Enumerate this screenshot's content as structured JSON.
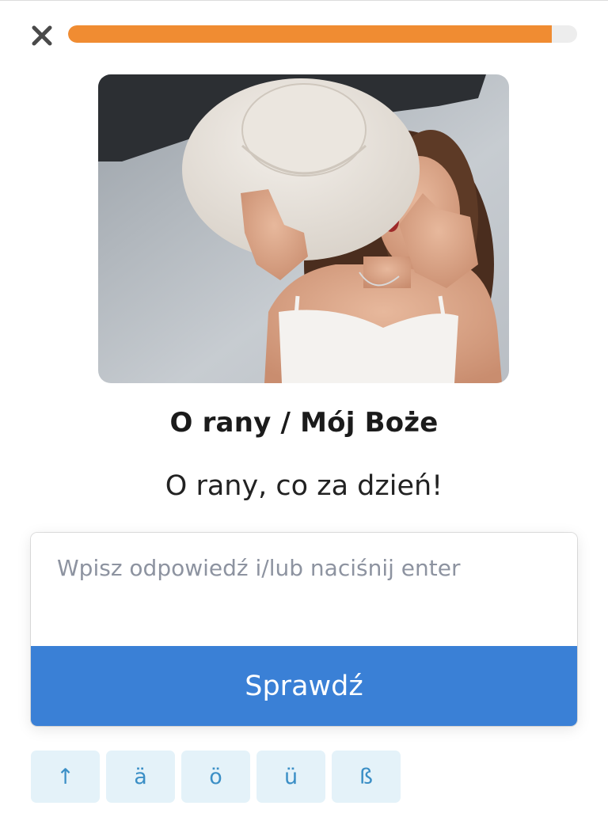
{
  "progress": {
    "fraction": 0.95,
    "color": "#f08c32"
  },
  "header": {
    "close_icon": "close-icon"
  },
  "card": {
    "title": "O rany / Mój Boże",
    "sentence": "O rany, co za dzień!"
  },
  "answer": {
    "placeholder": "Wpisz odpowiedź i/lub naciśnij enter",
    "value": ""
  },
  "check_button": {
    "label": "Sprawdź",
    "color": "#3a80d6"
  },
  "special_keys": [
    {
      "label": "↑",
      "name": "uppercase-toggle-key"
    },
    {
      "label": "ä"
    },
    {
      "label": "ö"
    },
    {
      "label": "ü"
    },
    {
      "label": "ß"
    }
  ]
}
